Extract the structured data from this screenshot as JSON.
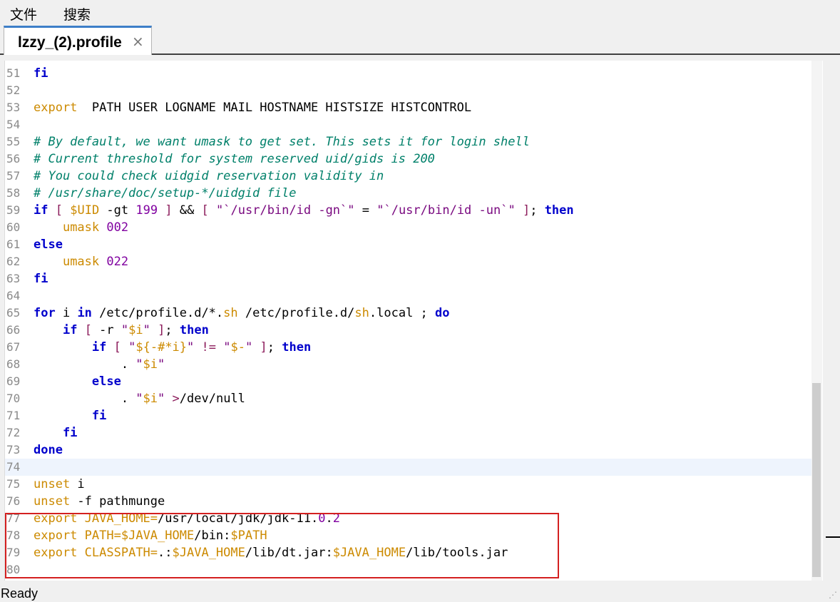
{
  "menu": {
    "file": "文件",
    "search": "搜索"
  },
  "tab": {
    "title": "lzzy_(2).profile",
    "close": "×"
  },
  "editor": {
    "lines": [
      {
        "n": "51",
        "code": [
          [
            "kw",
            "fi"
          ]
        ]
      },
      {
        "n": "52",
        "code": []
      },
      {
        "n": "53",
        "code": [
          [
            "bi",
            "export"
          ],
          [
            "",
            "  PATH USER LOGNAME MAIL HOSTNAME HISTSIZE HISTCONTROL"
          ]
        ]
      },
      {
        "n": "54",
        "code": []
      },
      {
        "n": "55",
        "code": [
          [
            "cm",
            "# By default, we want umask to get set. This sets it for login shell"
          ]
        ]
      },
      {
        "n": "56",
        "code": [
          [
            "cm",
            "# Current threshold for system reserved uid/gids is 200"
          ]
        ]
      },
      {
        "n": "57",
        "code": [
          [
            "cm",
            "# You could check uidgid reservation validity in"
          ]
        ]
      },
      {
        "n": "58",
        "code": [
          [
            "cm",
            "# /usr/share/doc/setup-*/uidgid file"
          ]
        ]
      },
      {
        "n": "59",
        "code": [
          [
            "kw",
            "if"
          ],
          [
            "",
            " "
          ],
          [
            "op",
            "["
          ],
          [
            "",
            " "
          ],
          [
            "vr",
            "$UID"
          ],
          [
            "",
            " -gt "
          ],
          [
            "nm",
            "199"
          ],
          [
            "",
            " "
          ],
          [
            "op",
            "]"
          ],
          [
            "",
            " && "
          ],
          [
            "op",
            "["
          ],
          [
            "",
            " "
          ],
          [
            "strd",
            "\"`/usr/bin/id -gn`\""
          ],
          [
            "",
            " = "
          ],
          [
            "strd",
            "\"`/usr/bin/id -un`\""
          ],
          [
            "",
            " "
          ],
          [
            "op",
            "]"
          ],
          [
            "",
            "; "
          ],
          [
            "kw",
            "then"
          ]
        ]
      },
      {
        "n": "60",
        "code": [
          [
            "",
            "    "
          ],
          [
            "bi",
            "umask"
          ],
          [
            "",
            " "
          ],
          [
            "nm",
            "002"
          ]
        ]
      },
      {
        "n": "61",
        "code": [
          [
            "kw",
            "else"
          ]
        ]
      },
      {
        "n": "62",
        "code": [
          [
            "",
            "    "
          ],
          [
            "bi",
            "umask"
          ],
          [
            "",
            " "
          ],
          [
            "nm",
            "022"
          ]
        ]
      },
      {
        "n": "63",
        "code": [
          [
            "kw",
            "fi"
          ]
        ]
      },
      {
        "n": "64",
        "code": []
      },
      {
        "n": "65",
        "code": [
          [
            "kw",
            "for"
          ],
          [
            "",
            " i "
          ],
          [
            "kw",
            "in"
          ],
          [
            "",
            " /etc/profile.d/*."
          ],
          [
            "bi",
            "sh"
          ],
          [
            "",
            " /etc/profile.d/"
          ],
          [
            "bi",
            "sh"
          ],
          [
            "",
            ".local ; "
          ],
          [
            "kw",
            "do"
          ]
        ]
      },
      {
        "n": "66",
        "code": [
          [
            "",
            "    "
          ],
          [
            "kw",
            "if"
          ],
          [
            "",
            " "
          ],
          [
            "op",
            "["
          ],
          [
            "",
            " -r "
          ],
          [
            "strd",
            "\""
          ],
          [
            "vr",
            "$i"
          ],
          [
            "strd",
            "\""
          ],
          [
            "",
            " "
          ],
          [
            "op",
            "]"
          ],
          [
            "",
            "; "
          ],
          [
            "kw",
            "then"
          ]
        ]
      },
      {
        "n": "67",
        "code": [
          [
            "",
            "        "
          ],
          [
            "kw",
            "if"
          ],
          [
            "",
            " "
          ],
          [
            "op",
            "["
          ],
          [
            "",
            " "
          ],
          [
            "strd",
            "\""
          ],
          [
            "vr",
            "${-#*i}"
          ],
          [
            "strd",
            "\""
          ],
          [
            "",
            " "
          ],
          [
            "op",
            "!="
          ],
          [
            "",
            " "
          ],
          [
            "strd",
            "\""
          ],
          [
            "vr",
            "$-"
          ],
          [
            "strd",
            "\""
          ],
          [
            "",
            " "
          ],
          [
            "op",
            "]"
          ],
          [
            "",
            "; "
          ],
          [
            "kw",
            "then"
          ]
        ]
      },
      {
        "n": "68",
        "code": [
          [
            "",
            "            . "
          ],
          [
            "strd",
            "\""
          ],
          [
            "vr",
            "$i"
          ],
          [
            "strd",
            "\""
          ]
        ]
      },
      {
        "n": "69",
        "code": [
          [
            "",
            "        "
          ],
          [
            "kw",
            "else"
          ]
        ]
      },
      {
        "n": "70",
        "code": [
          [
            "",
            "            . "
          ],
          [
            "strd",
            "\""
          ],
          [
            "vr",
            "$i"
          ],
          [
            "strd",
            "\""
          ],
          [
            "",
            " "
          ],
          [
            "op",
            ">"
          ],
          [
            "",
            "/dev/null"
          ]
        ]
      },
      {
        "n": "71",
        "code": [
          [
            "",
            "        "
          ],
          [
            "kw",
            "fi"
          ]
        ]
      },
      {
        "n": "72",
        "code": [
          [
            "",
            "    "
          ],
          [
            "kw",
            "fi"
          ]
        ]
      },
      {
        "n": "73",
        "code": [
          [
            "kw",
            "done"
          ]
        ]
      },
      {
        "n": "74",
        "code": [],
        "current": true
      },
      {
        "n": "75",
        "code": [
          [
            "bi",
            "unset"
          ],
          [
            "",
            " i"
          ]
        ]
      },
      {
        "n": "76",
        "code": [
          [
            "bi",
            "unset"
          ],
          [
            "",
            " -f pathmunge"
          ]
        ]
      },
      {
        "n": "77",
        "code": [
          [
            "bi",
            "export"
          ],
          [
            "",
            " "
          ],
          [
            "vr",
            "JAVA_HOME="
          ],
          [
            "",
            "/usr/local/jdk/jdk-11."
          ],
          [
            "nm",
            "0"
          ],
          [
            "",
            "."
          ],
          [
            "nm",
            "2"
          ]
        ]
      },
      {
        "n": "78",
        "code": [
          [
            "bi",
            "export"
          ],
          [
            "",
            " "
          ],
          [
            "vr",
            "PATH="
          ],
          [
            "vr",
            "$JAVA_HOME"
          ],
          [
            "",
            "/bin:"
          ],
          [
            "vr",
            "$PATH"
          ]
        ]
      },
      {
        "n": "79",
        "code": [
          [
            "bi",
            "export"
          ],
          [
            "",
            " "
          ],
          [
            "vr",
            "CLASSPATH="
          ],
          [
            "",
            ".:"
          ],
          [
            "vr",
            "$JAVA_HOME"
          ],
          [
            "",
            "/lib/dt.jar:"
          ],
          [
            "vr",
            "$JAVA_HOME"
          ],
          [
            "",
            "/lib/tools.jar"
          ]
        ]
      },
      {
        "n": "80",
        "code": []
      }
    ]
  },
  "status": {
    "text": "Ready"
  },
  "colors": {
    "keyword": "#0000cc",
    "builtin": "#cc8a00",
    "comment": "#00806a",
    "number": "#8000a0",
    "highlight_box": "#d42020",
    "tab_accent": "#3d7fc8"
  }
}
